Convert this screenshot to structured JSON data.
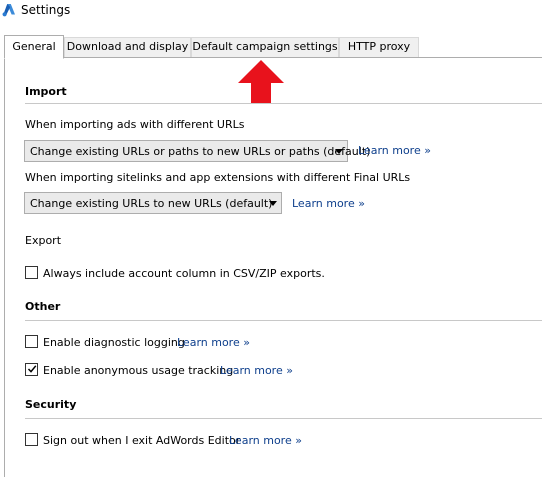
{
  "window": {
    "title": "Settings",
    "icon": "adwords-logo-icon"
  },
  "tabs": [
    {
      "label": "General",
      "active": true
    },
    {
      "label": "Download and display",
      "active": false
    },
    {
      "label": "Default campaign settings",
      "active": false
    },
    {
      "label": "HTTP proxy",
      "active": false
    }
  ],
  "annotation": {
    "icon": "red-arrow-up-icon",
    "color": "#e8121c"
  },
  "import": {
    "heading": "Import",
    "ads_urls": {
      "label": "When importing ads with different URLs",
      "selected": "Change existing URLs or paths to new URLs or paths (default)",
      "learn_more": "Learn more »"
    },
    "sitelinks": {
      "label": "When importing sitelinks and app extensions with different Final URLs",
      "selected": "Change existing URLs to new URLs (default)",
      "learn_more": "Learn more »"
    }
  },
  "export": {
    "heading": "Export",
    "account_column": {
      "label": "Always include account column in CSV/ZIP exports.",
      "checked": false
    }
  },
  "other": {
    "heading": "Other",
    "diagnostic_logging": {
      "label": "Enable diagnostic logging",
      "checked": false,
      "learn_more": "Learn more »"
    },
    "usage_tracking": {
      "label": "Enable anonymous usage tracking",
      "checked": true,
      "learn_more": "Learn more »"
    }
  },
  "security": {
    "heading": "Security",
    "sign_out": {
      "label": "Sign out when I exit AdWords Editor",
      "checked": false,
      "learn_more": "Learn more »"
    }
  }
}
